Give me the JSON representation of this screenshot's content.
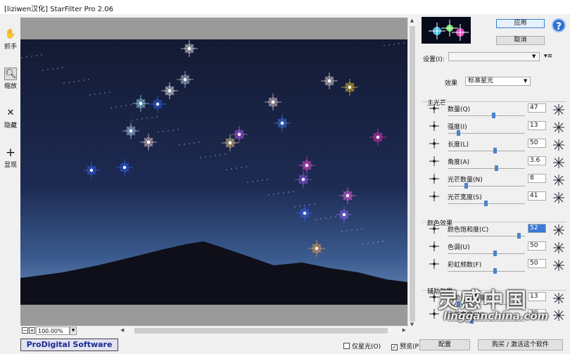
{
  "window": {
    "title": "[liziwen汉化] StarFilter Pro 2.06"
  },
  "tools": [
    {
      "label": "抓手"
    },
    {
      "label": "缩放"
    },
    {
      "label": "隐藏"
    },
    {
      "label": "显现"
    }
  ],
  "view": {
    "zoom_value": "100.00%"
  },
  "footer": {
    "brand": "ProDigital Software",
    "only_star_label": "仅星光(O)",
    "preview_label": "预览(P)",
    "config_label": "配置",
    "buy_label": "购买 / 激活这个软件"
  },
  "panel": {
    "apply_label": "应用",
    "cancel_label": "取消",
    "help_label": "?",
    "settings_label": "设置(I):",
    "settings_value": "",
    "effect_label": "效果",
    "effect_value": "标准星光",
    "main_group": "主光芒",
    "color_group": "颜色效果",
    "aux_group": "辅助效果",
    "main_rows": [
      {
        "name": "数量(Q)",
        "value": "47",
        "pos": 0.58
      },
      {
        "name": "强度(I)",
        "value": "13",
        "pos": 0.12
      },
      {
        "name": "长度(L)",
        "value": "50",
        "pos": 0.6
      },
      {
        "name": "角度(A)",
        "value": "3.6",
        "pos": 0.62
      },
      {
        "name": "光芒数量(N)",
        "value": "8",
        "pos": 0.22
      },
      {
        "name": "光芒宽度(S)",
        "value": "41",
        "pos": 0.48
      }
    ],
    "color_rows": [
      {
        "name": "颜色饱和度(C)",
        "value": "52",
        "pos": 0.92,
        "selected": true
      },
      {
        "name": "色调(U)",
        "value": "50",
        "pos": 0.6,
        "selected": false
      },
      {
        "name": "彩虹频数(F)",
        "value": "50",
        "pos": 0.6,
        "selected": false
      }
    ],
    "aux_rows": [
      {
        "name": "辅助光芒强度(G)",
        "value": "13",
        "pos": 0.12
      },
      {
        "name": "光芒宽度(W)",
        "value": "30",
        "pos": 0.3
      }
    ]
  },
  "watermark": {
    "line1": "灵感中国",
    "line2": "lingganchina.com"
  }
}
